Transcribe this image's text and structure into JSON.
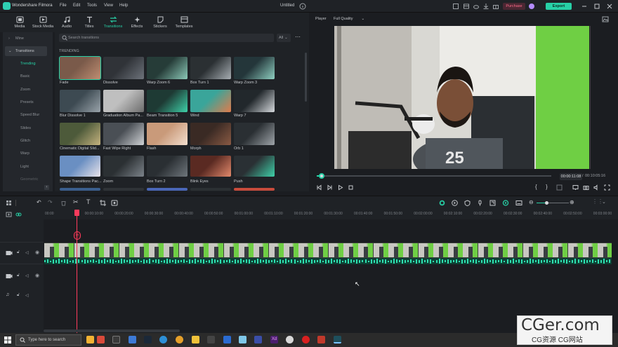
{
  "app": {
    "name": "Wondershare Filmora",
    "doc_title": "Untitled"
  },
  "menu": [
    "File",
    "Edit",
    "Tools",
    "View",
    "Help"
  ],
  "titlebar": {
    "purchase_label": "Purchase",
    "export_label": "Export"
  },
  "media_toolbar": [
    {
      "label": "Media",
      "icon": "media-icon"
    },
    {
      "label": "Stock Media",
      "icon": "stock-media-icon"
    },
    {
      "label": "Audio",
      "icon": "audio-icon"
    },
    {
      "label": "Titles",
      "icon": "titles-icon"
    },
    {
      "label": "Transitions",
      "icon": "transitions-icon",
      "active": true
    },
    {
      "label": "Effects",
      "icon": "effects-icon"
    },
    {
      "label": "Stickers",
      "icon": "stickers-icon"
    },
    {
      "label": "Templates",
      "icon": "templates-icon"
    }
  ],
  "leftnav": {
    "sections": [
      "Mine",
      "Transitions"
    ],
    "items": [
      "Trending",
      "Basic",
      "Zoom",
      "Presets",
      "Speed Blur",
      "Slides",
      "Glitch",
      "Warp",
      "Light",
      "Geometric"
    ],
    "active": "Trending"
  },
  "browser": {
    "search_placeholder": "Search transitions",
    "filter_value": "All",
    "section_label": "TRENDING",
    "items": [
      "Fade",
      "Dissolve",
      "Warp Zoom 6",
      "Box Turn 1",
      "Warp Zoom 3",
      "Blur Dissolve 1",
      "Graduation Album Pa...",
      "Beam Transition 5",
      "Wind",
      "Warp 7",
      "Cinematic Digital Slid...",
      "Fast Wipe Right",
      "Flash",
      "Morph",
      "Orb 1",
      "Shape Transitions Pac...",
      "Zoom",
      "Box Turn 2",
      "Blink Eyes",
      "Push"
    ]
  },
  "player": {
    "label": "Player",
    "quality": "Full Quality",
    "current_time": "00:00:11:08",
    "total_time": "00:10:05:16",
    "progress_fraction": 0.02
  },
  "timeline": {
    "ruler_ticks": [
      "00:00",
      "00:00:10:00",
      "00:00:20:00",
      "00:00:30:00",
      "00:00:40:00",
      "00:00:50:00",
      "00:01:00:00",
      "00:01:10:00",
      "00:01:20:00",
      "00:01:30:00",
      "00:01:40:00",
      "00:01:50:00",
      "00:02:00:00",
      "00:02:10:00",
      "00:02:20:00",
      "00:02:30:00",
      "00:02:40:00",
      "00:02:50:00",
      "00:03:00:00"
    ],
    "tracks": [
      "video-2",
      "video-1",
      "audio-1"
    ]
  },
  "taskbar": {
    "search_placeholder": "Type here to search"
  },
  "watermark": {
    "big": "CGer.com",
    "small": "CG资源  CG网站"
  },
  "colors": {
    "accent": "#27d0a6",
    "purchase": "#ff6b8a",
    "playhead": "#ff3b5c"
  }
}
